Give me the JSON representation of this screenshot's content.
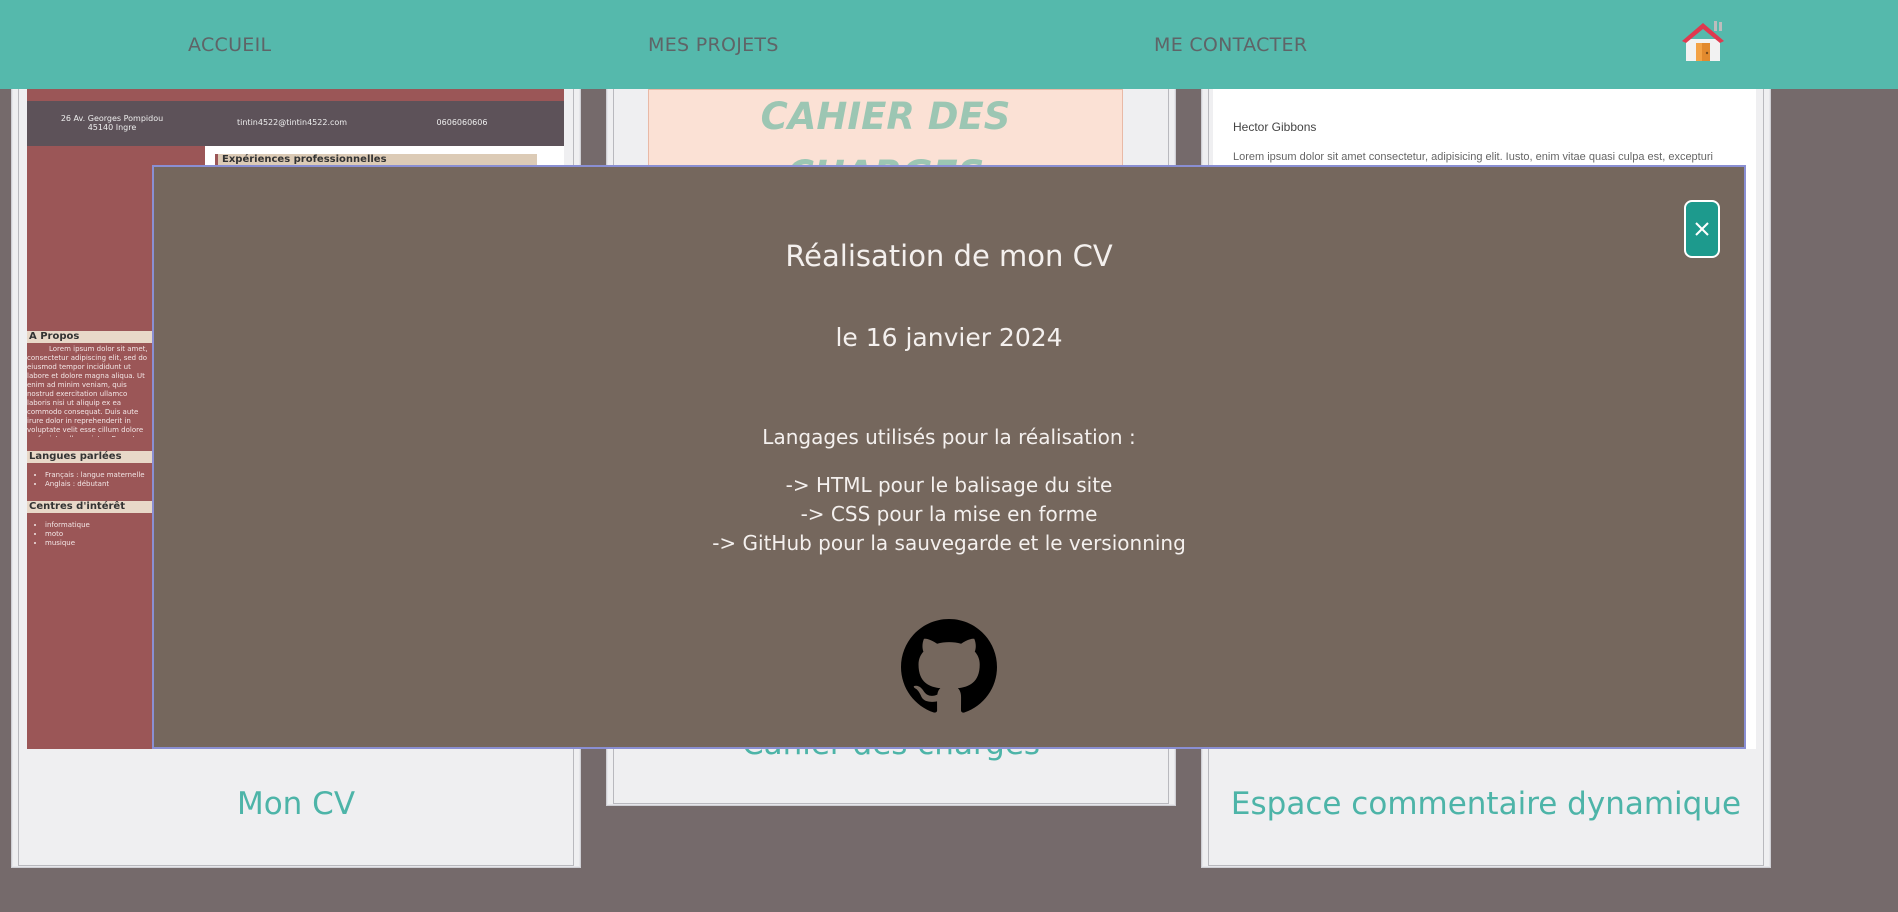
{
  "nav": {
    "links": [
      "ACCUEIL",
      "MES PROJETS",
      "ME CONTACTER"
    ]
  },
  "cards": [
    {
      "title": "Mon CV"
    },
    {
      "title": "Cahier des charges"
    },
    {
      "title": "Espace commentaire dynamique"
    }
  ],
  "cv_preview": {
    "address": "26 Av. Georges Pompidou\n45140 Ingre",
    "email": "tintin4522@tintin4522.com",
    "phone": "0606060606",
    "experience_heading": "Expériences professionnelles",
    "about_heading": "A Propos",
    "about_text": "Lorem ipsum dolor sit amet, consectetur adipiscing elit, sed do eiusmod tempor incididunt ut labore et dolore magna aliqua. Ut enim ad minim veniam, quis nostrud exercitation ullamco laboris nisi ut aliquip ex ea commodo consequat. Duis aute irure dolor in reprehenderit in voluptate velit esse cillum dolore eu fugiat nulla pariatur. Excepteur sint occaecat cupidatat non proident, sunt in culpa qui officia deserunt mollit anim id est laborum",
    "languages_heading": "Langues parlées",
    "languages": [
      "Français : langue maternelle",
      "Anglais : débutant"
    ],
    "interests_heading": "Centres d'intérêt",
    "interests": [
      "informatique",
      "moto",
      "musique"
    ]
  },
  "cahier_preview": {
    "title_line1": "CAHIER DES",
    "title_line2": "CHARGES"
  },
  "comment_preview": {
    "author": "Hector Gibbons",
    "text": "Lorem ipsum dolor sit amet consectetur, adipisicing elit. Iusto, enim vitae quasi culpa est, excepturi"
  },
  "modal": {
    "title": "Réalisation de mon CV",
    "date": "le 16 janvier 2024",
    "intro": "Langages utilisés pour la réalisation :",
    "lines": [
      "-> HTML pour le balisage du site",
      "-> CSS pour la mise en forme",
      "-> GitHub pour la sauvegarde et le versionning"
    ],
    "close_label": "×"
  },
  "icons": {
    "home": "home-icon",
    "github": "github-icon",
    "close": "close-icon"
  },
  "colors": {
    "header": "#55b9ac",
    "background": "#756a6b",
    "modal": "#75675d",
    "accent": "#4db4a8",
    "close_button": "#1d9a8d"
  }
}
